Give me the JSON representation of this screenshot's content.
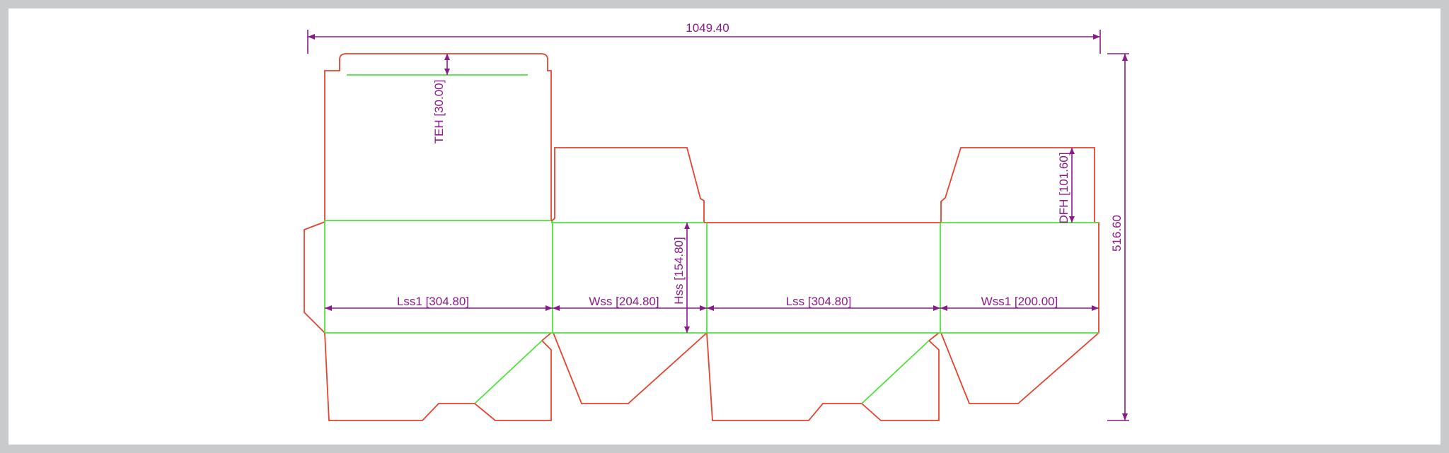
{
  "colors": {
    "cut": "#e8412e",
    "crease": "#4fe33b",
    "dimension": "#8a1a8a",
    "background": "#ffffff",
    "border": "#c9cacb"
  },
  "dimensions": {
    "overall_width": "1049.40",
    "overall_height": "516.60",
    "teh": "TEH [30.00]",
    "dfh": "DFH [101.60]",
    "hss": "Hss [154.80]",
    "lss1": "Lss1 [304.80]",
    "wss": "Wss [204.80]",
    "lss": "Lss [304.80]",
    "wss1": "Wss1 [200.00]"
  }
}
